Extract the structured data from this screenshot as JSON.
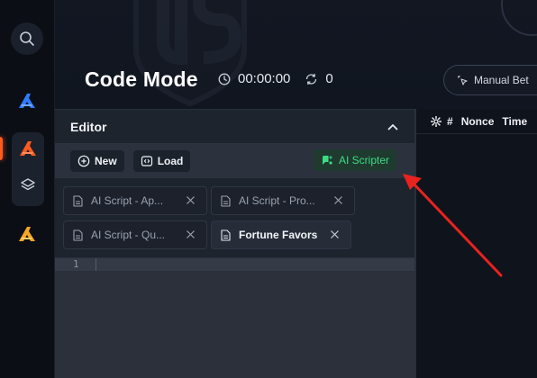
{
  "header": {
    "title": "Code Mode",
    "timer": "00:00:00",
    "repeat_count": "0",
    "manual_bet_label": "Manual Bet"
  },
  "editor": {
    "title": "Editor",
    "new_label": "New",
    "load_label": "Load",
    "ai_label": "AI Scripter",
    "tabs": [
      {
        "label": "AI Script - Ap..."
      },
      {
        "label": "AI Script - Pro..."
      },
      {
        "label": "AI Script - Qu..."
      },
      {
        "label": "Fortune Favors"
      }
    ],
    "line_number": "1"
  },
  "results": {
    "col_hash": "#",
    "col_nonce": "Nonce",
    "col_time": "Time"
  },
  "colors": {
    "accent_orange": "#ff5a1f",
    "accent_green": "#3ddc84",
    "annotation_red": "#e8231f"
  }
}
